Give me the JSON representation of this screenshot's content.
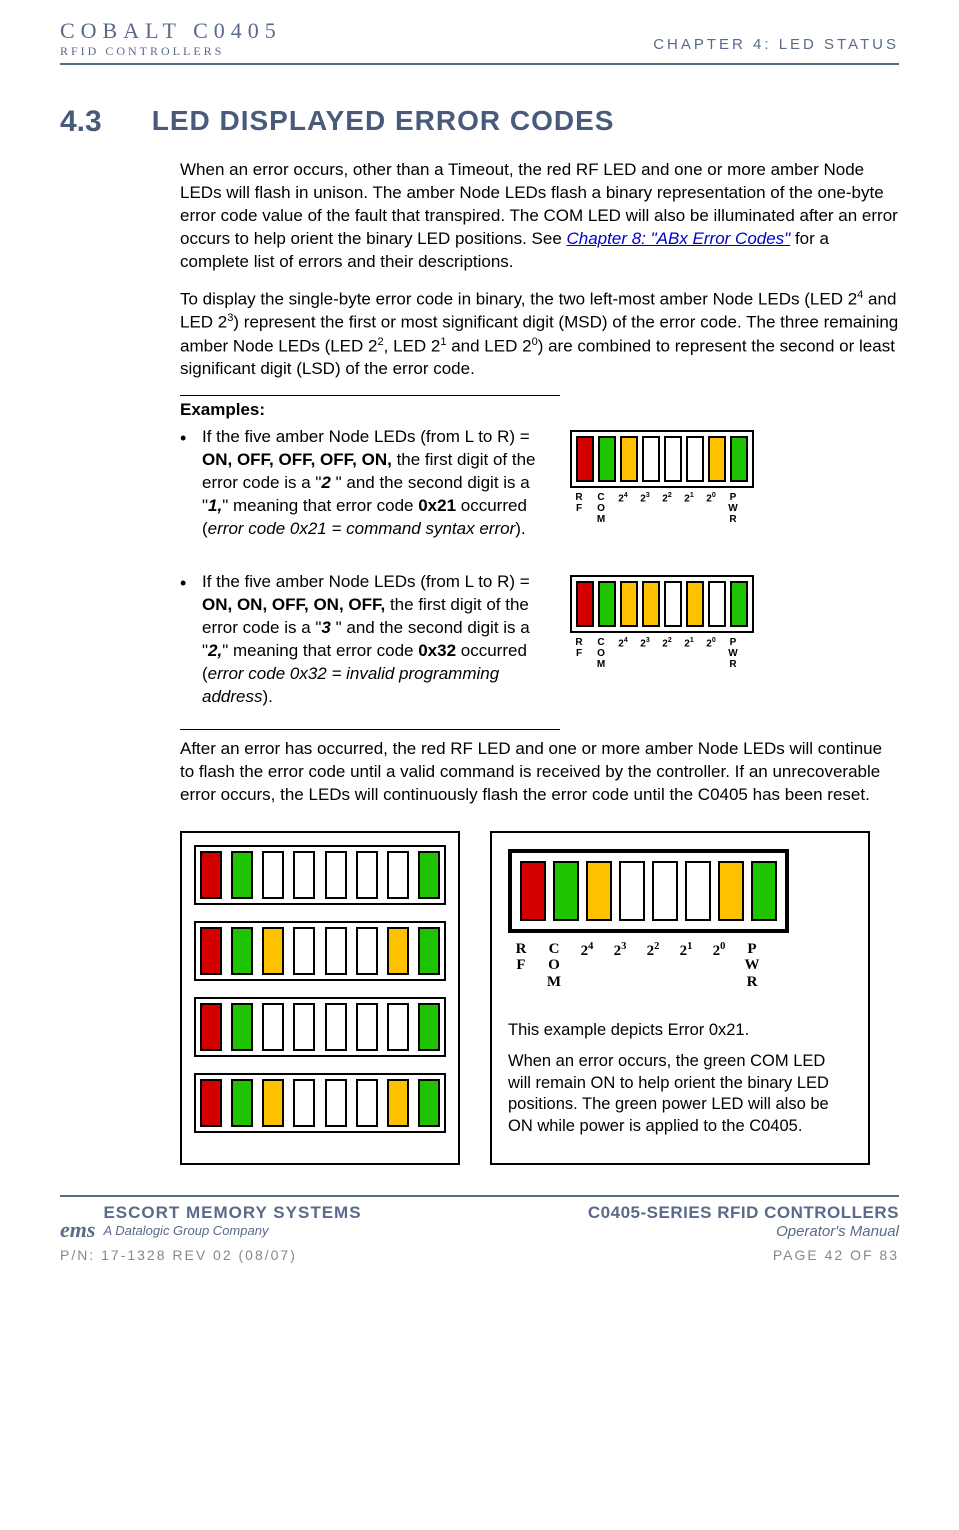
{
  "header": {
    "brand_top": "COBALT C0405",
    "brand_sub": "RFID CONTROLLERS",
    "chapter": "CHAPTER 4: LED STATUS"
  },
  "section": {
    "num": "4.3",
    "title": "LED DISPLAYED ERROR CODES"
  },
  "p1_a": "When an error occurs, other than a Timeout, the red RF LED and one or more amber Node LEDs will flash in unison. The amber Node LEDs flash a binary representation of the one-byte error code value of the fault that transpired. The COM LED will also be illuminated after an error occurs to help orient the binary LED positions. See ",
  "p1_link": "Chapter 8: \"ABx Error Codes\"",
  "p1_b": " for a complete list of errors and their descriptions.",
  "p2_a": "To display the single-byte error code in binary, the two left-most amber Node LEDs (LED 2",
  "p2_b": " and LED 2",
  "p2_c": ") represent the first or most significant digit (MSD) of the error code. The three remaining amber Node LEDs (LED 2",
  "p2_d": ", LED 2",
  "p2_e": " and LED 2",
  "p2_f": ") are combined to represent the second or least significant digit (LSD) of the error code.",
  "examples_label": "Examples",
  "ex1": {
    "prefix": "If the five amber Node LEDs (from L to R) = ",
    "pattern": "ON, OFF, OFF, OFF, ON,",
    "mid1": " the first digit of the error code is a \"",
    "d1": "2",
    "mid2": " \" and the second digit is a \"",
    "d2": "1,",
    "mid3": "\" meaning that error code ",
    "code": "0x21",
    "mid4": " occurred (",
    "desc": "error code 0x21 = command syntax error",
    "end": ")."
  },
  "ex2": {
    "prefix": "If the five amber Node LEDs (from L to R) = ",
    "pattern": "ON, ON, OFF, ON, OFF,",
    "mid1": " the first digit of the error code is a \"",
    "d1": "3",
    "mid2": " \" and the second digit is a \"",
    "d2": "2,",
    "mid3": "\" meaning that error code ",
    "code": "0x32",
    "mid4": " occurred (",
    "desc": "error code 0x32 = invalid programming address",
    "end": ")."
  },
  "after": "After an error has occurred, the red RF LED and one or more amber Node LEDs will continue to flash the error code until a valid command is received by the controller. If an unrecoverable error occurs, the LEDs will continuously flash the error code until the C0405 has been reset.",
  "big_panel": {
    "p1": "This example depicts Error 0x21.",
    "p2": "When an error occurs, the green COM LED will remain ON to help orient the binary LED positions. The green power LED will also be ON while power is applied to the C0405."
  },
  "labels": {
    "rf": "R\nF",
    "com": "C\nO\nM",
    "l4": "4",
    "l3": "3",
    "l2": "2",
    "l1": "1",
    "l0": "0",
    "pwr": "P\nW\nR",
    "two": "2"
  },
  "footer": {
    "ems_logo": "ems",
    "ems_l1": "ESCORT MEMORY SYSTEMS",
    "ems_l2": "A Datalogic Group Company",
    "r_l1": "C0405-SERIES RFID CONTROLLERS",
    "r_l2": "Operator's Manual",
    "pn": "P/N: 17-1328 REV 02 (08/07)",
    "page": "PAGE 42 OF 83"
  }
}
